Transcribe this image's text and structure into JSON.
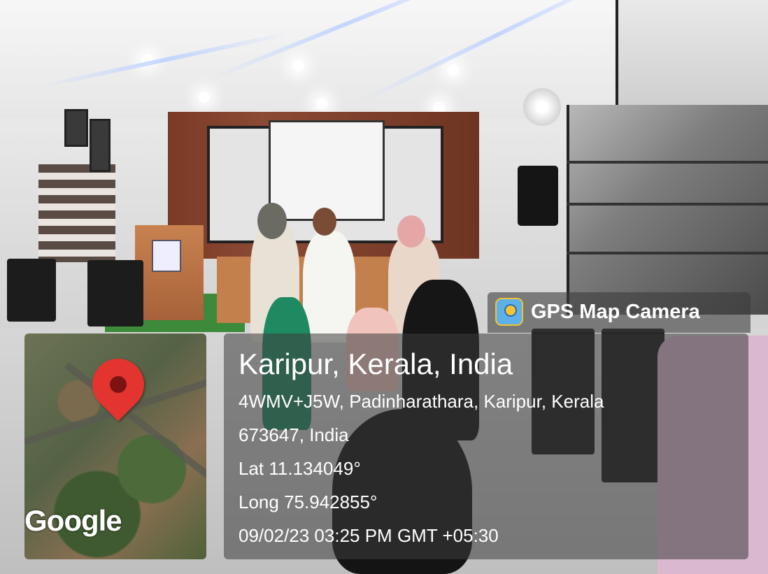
{
  "badge": {
    "app_name": "GPS Map Camera",
    "icon": "gps-map-camera-app-icon"
  },
  "map": {
    "brand": "Google",
    "pin_icon": "map-pin-icon",
    "pin_color": "#e3342f"
  },
  "location": {
    "title": "Karipur, Kerala, India",
    "address_line1": "4WMV+J5W, Padinharathara, Karipur, Kerala",
    "address_line2": "673647, India",
    "lat": "Lat 11.134049°",
    "long": "Long 75.942855°",
    "datetime": "09/02/23 03:25 PM GMT +05:30"
  }
}
